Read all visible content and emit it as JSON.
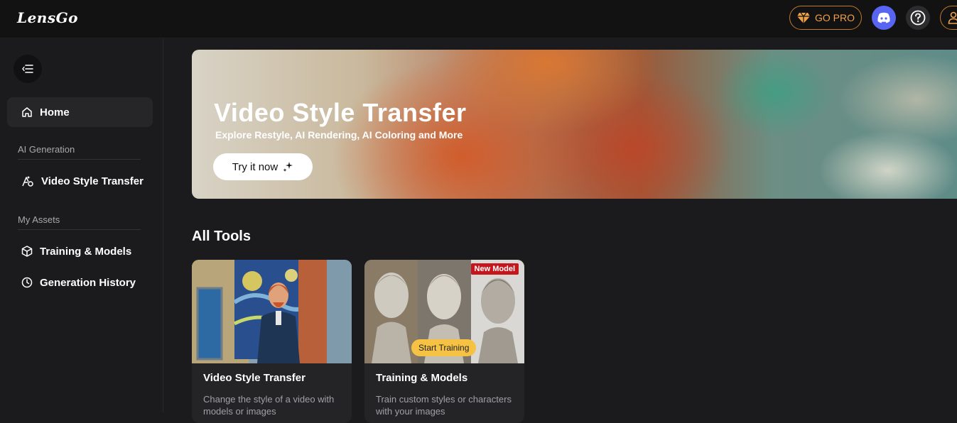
{
  "app": {
    "logo": "LensGo",
    "go_pro": "GO PRO"
  },
  "sidebar": {
    "home": "Home",
    "sections": [
      {
        "label": "AI Generation",
        "items": [
          "Video Style Transfer"
        ]
      },
      {
        "label": "My Assets",
        "items": [
          "Training & Models",
          "Generation History"
        ]
      }
    ]
  },
  "hero": {
    "title": "Video Style Transfer",
    "subtitle": "Explore Restyle, AI Rendering, AI Coloring and More",
    "cta": "Try it now"
  },
  "tools": {
    "heading": "All Tools",
    "cards": [
      {
        "title": "Video Style Transfer",
        "desc": "Change the style of a video with models or images"
      },
      {
        "title": "Training & Models",
        "desc": "Train custom styles or characters with your images",
        "badge": "New Model",
        "overlay": "Start Training"
      }
    ]
  },
  "colors": {
    "accent_orange": "#f0a14a",
    "discord": "#5865f2",
    "badge_red": "#c5161d",
    "badge_yellow": "#f6c244"
  }
}
